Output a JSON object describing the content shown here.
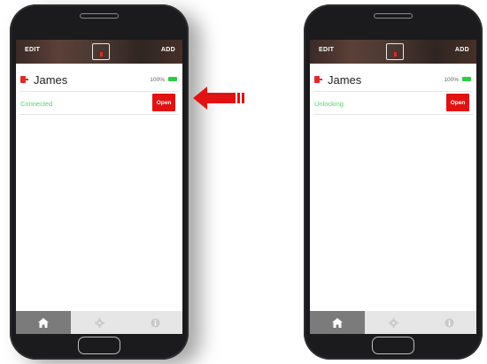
{
  "phones": [
    {
      "header": {
        "edit_label": "EDIT",
        "add_label": "ADD"
      },
      "lock": {
        "name": "James",
        "battery": "100%",
        "status": "Connected",
        "open_label": "Open"
      },
      "nav": [
        "home-icon",
        "gear-icon",
        "info-icon"
      ]
    },
    {
      "header": {
        "edit_label": "EDIT",
        "add_label": "ADD"
      },
      "lock": {
        "name": "James",
        "battery": "100%",
        "status": "Unlocking",
        "open_label": "Open"
      },
      "nav": [
        "home-icon",
        "gear-icon",
        "info-icon"
      ]
    }
  ],
  "colors": {
    "accent_red": "#e21212",
    "status_green": "#4cd964",
    "battery_green": "#2ecc40",
    "active_tab": "#7b7b7b"
  },
  "annotation": {
    "icon": "left-arrow-icon"
  }
}
